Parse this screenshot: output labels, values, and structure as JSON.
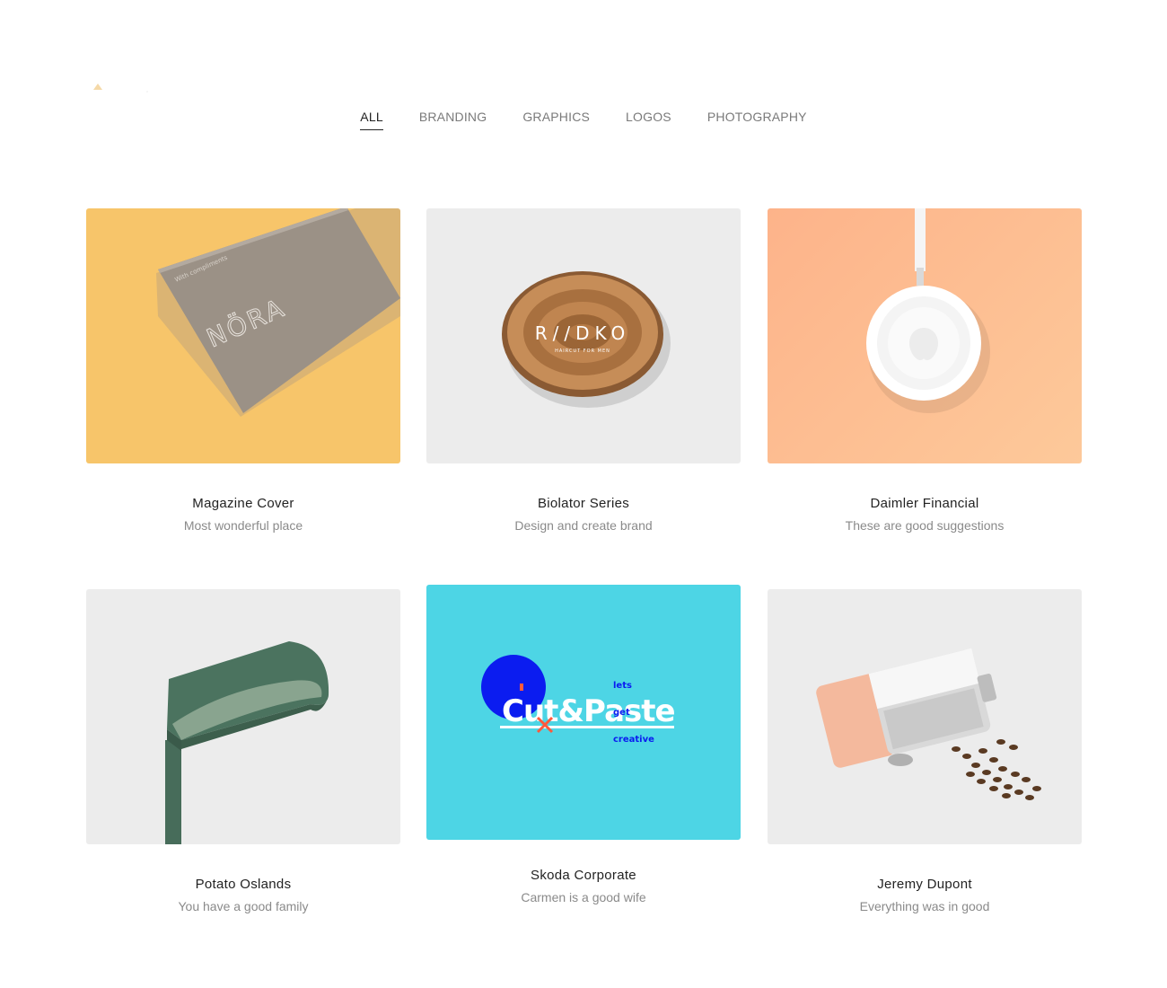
{
  "filters": [
    {
      "label": "ALL",
      "active": true
    },
    {
      "label": "BRANDING",
      "active": false
    },
    {
      "label": "GRAPHICS",
      "active": false
    },
    {
      "label": "LOGOS",
      "active": false
    },
    {
      "label": "PHOTOGRAPHY",
      "active": false
    }
  ],
  "projects": [
    {
      "title": "Magazine Cover",
      "subtitle": "Most wonderful place",
      "bg": "#f7c56a",
      "art_text": {
        "brand": "NÖRA",
        "small": "With compliments"
      }
    },
    {
      "title": "Biolator Series",
      "subtitle": "Design and create brand",
      "bg": "#ececec",
      "art_text": {
        "brand": "R//DKO",
        "small": "HAIRCUT FOR MEN"
      }
    },
    {
      "title": "Daimler Financial",
      "subtitle": "These are good suggestions",
      "bg": "#fdbf93"
    },
    {
      "title": "Potato Oslands",
      "subtitle": "You have a good family",
      "bg": "#ececec"
    },
    {
      "title": "Skoda Corporate",
      "subtitle": "Carmen is a good wife",
      "bg": "#4dd5e5",
      "art_text": {
        "brand": "Cut&Paste",
        "w1": "lets",
        "w2": "get",
        "w3": "creative"
      }
    },
    {
      "title": "Jeremy Dupont",
      "subtitle": "Everything was in good",
      "bg": "#ececec"
    }
  ]
}
